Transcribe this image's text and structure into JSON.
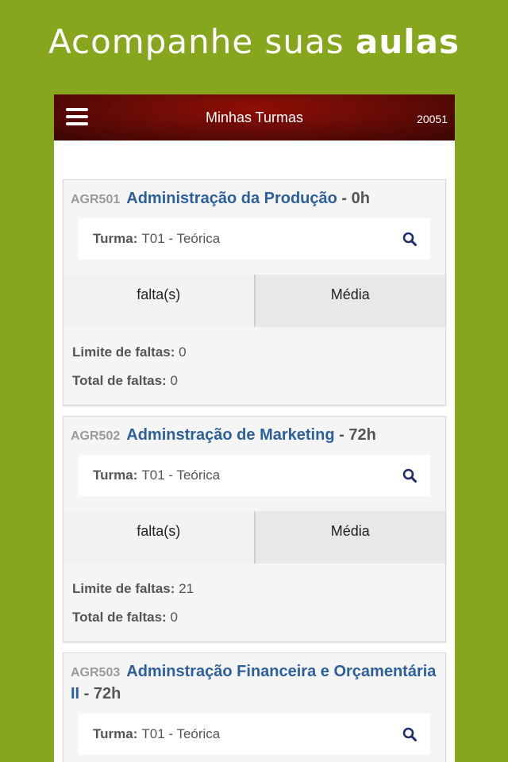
{
  "promo": {
    "text_regular": "Acompanhe suas",
    "text_bold": "aulas"
  },
  "appbar": {
    "title": "Minhas Turmas",
    "user_code": "20051"
  },
  "labels": {
    "turma": "Turma:",
    "tab_faltas": "falta(s)",
    "tab_media": "Média",
    "limite": "Limite de faltas:",
    "total": "Total de faltas:"
  },
  "courses": [
    {
      "code": "AGR501",
      "name": "Administração da Produção",
      "hours": " - 0h",
      "turma": "T01 - Teórica",
      "limite": "0",
      "total": "0"
    },
    {
      "code": "AGR502",
      "name": "Adminstração de Marketing",
      "hours": " - 72h",
      "turma": "T01 - Teórica",
      "limite": "21",
      "total": "0"
    },
    {
      "code": "AGR503",
      "name": "Adminstração Financeira e Orçamentária II",
      "hours": " - 72h",
      "turma": "T01 - Teórica"
    }
  ],
  "colors": {
    "background": "#86a61e",
    "appbar": "#6a0b06",
    "course_name": "#2d5f9a",
    "search_icon": "#1f2a6b"
  }
}
